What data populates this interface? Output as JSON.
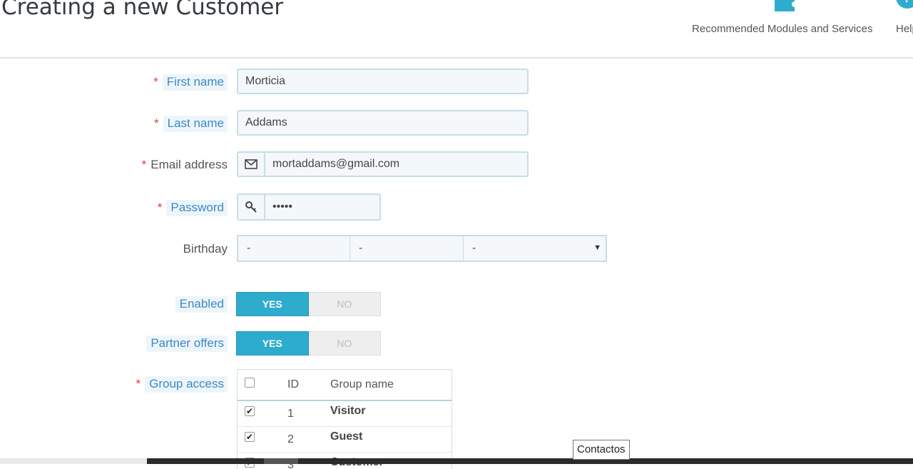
{
  "header": {
    "title": "Creating a new Customer",
    "toolbar": [
      {
        "label": "Recommended Modules and Services",
        "icon": "puzzle-icon"
      },
      {
        "label": "Help",
        "icon": "help-icon"
      }
    ]
  },
  "form": {
    "first_name": {
      "label": "First name",
      "value": "Morticia",
      "required": true
    },
    "last_name": {
      "label": "Last name",
      "value": "Addams",
      "required": true
    },
    "email": {
      "label": "Email address",
      "value": "mortaddams@gmail.com",
      "required": true,
      "icon": "envelope-icon"
    },
    "password": {
      "label": "Password",
      "value": "•••••",
      "required": true,
      "icon": "key-icon"
    },
    "birthday": {
      "label": "Birthday",
      "day": "-",
      "month": "-",
      "year": "-"
    },
    "enabled": {
      "label": "Enabled",
      "yes": "YES",
      "no": "NO",
      "selected": "YES"
    },
    "partner_offers": {
      "label": "Partner offers",
      "yes": "YES",
      "no": "NO",
      "selected": "YES"
    },
    "group_access": {
      "label": "Group access",
      "required": true,
      "columns": [
        "ID",
        "Group name"
      ],
      "rows": [
        {
          "id": "1",
          "name": "Visitor",
          "checked": true
        },
        {
          "id": "2",
          "name": "Guest",
          "checked": true
        },
        {
          "id": "3",
          "name": "Customer",
          "checked": true
        }
      ]
    }
  },
  "tooltip": "Contactos",
  "colors": {
    "accent": "#2eacce",
    "required": "#e23b3b",
    "hint_text": "#3b89c6"
  }
}
